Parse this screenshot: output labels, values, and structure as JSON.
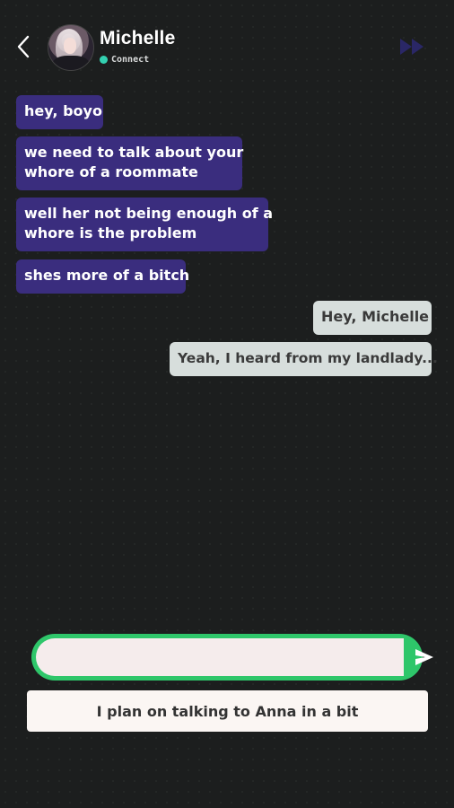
{
  "header": {
    "contact_name": "Michelle",
    "status_text": "Connect",
    "status_color": "#33d1b1",
    "back_icon": "chevron-left-icon",
    "skip_icon": "fast-forward-icon"
  },
  "messages": [
    {
      "from": "contact",
      "text": [
        "hey, boyo"
      ]
    },
    {
      "from": "contact",
      "text": [
        "we need to talk about your",
        "whore of a roommate"
      ]
    },
    {
      "from": "contact",
      "text": [
        "well her not being enough of a",
        "whore is the problem"
      ]
    },
    {
      "from": "contact",
      "text": [
        "shes more of a bitch"
      ]
    },
    {
      "from": "user",
      "text": [
        "Hey, Michelle"
      ]
    },
    {
      "from": "user",
      "text": [
        "Yeah, I heard from my landlady..."
      ]
    }
  ],
  "composer": {
    "value": "",
    "placeholder": "",
    "send_icon": "send-icon",
    "accent_color": "#2ec66a"
  },
  "suggestion": {
    "label": "I plan on talking to Anna in a bit"
  },
  "colors": {
    "incoming_bubble": "#3a2d7e",
    "outgoing_bubble": "#d7dedc",
    "background": "#1c1e1e"
  }
}
